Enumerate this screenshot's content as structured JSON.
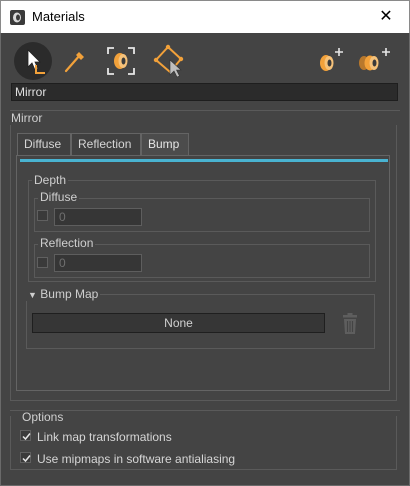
{
  "window": {
    "title": "Materials",
    "close_glyph": "✕",
    "app_icon": "materials-app-icon"
  },
  "toolbar": {
    "tools": [
      {
        "name": "select-tool",
        "icon": "cursor-select-icon"
      },
      {
        "name": "eyedropper-tool",
        "icon": "eyedropper-icon"
      },
      {
        "name": "focus-material-tool",
        "icon": "focus-material-icon"
      },
      {
        "name": "pick-from-scene-tool",
        "icon": "pick-scene-icon"
      },
      {
        "name": "add-material-button",
        "icon": "add-material-icon"
      },
      {
        "name": "add-multi-material-button",
        "icon": "add-multi-material-icon"
      }
    ]
  },
  "material_name": "Mirror",
  "mirror_section": {
    "label": "Mirror"
  },
  "tabs": [
    {
      "label": "Diffuse",
      "active": false
    },
    {
      "label": "Reflection",
      "active": false
    },
    {
      "label": "Bump",
      "active": true
    }
  ],
  "depth": {
    "title": "Depth",
    "diffuse": {
      "title": "Diffuse",
      "checked": false,
      "value": "0"
    },
    "reflection": {
      "title": "Reflection",
      "checked": false,
      "value": "0"
    }
  },
  "bump_map": {
    "title": "Bump Map",
    "texture_label": "None",
    "delete_icon": "trash-icon"
  },
  "options": {
    "title": "Options",
    "items": [
      {
        "label": "Link map transformations",
        "checked": true
      },
      {
        "label": "Use mipmaps in software antialiasing",
        "checked": true
      }
    ]
  },
  "colors": {
    "accent": "#49b3d1",
    "panel": "#444444",
    "field": "#2b2b2b",
    "icon_orange": "#f2a13a"
  }
}
